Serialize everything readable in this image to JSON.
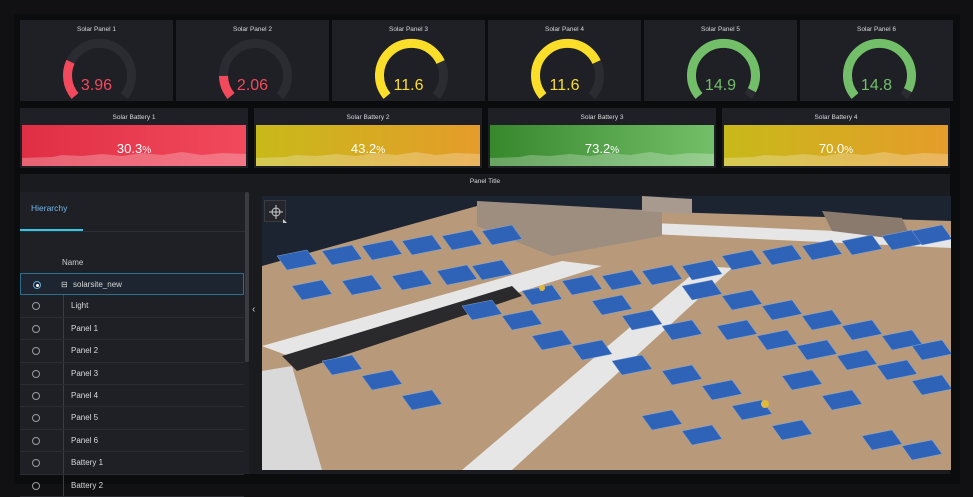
{
  "gauges": [
    {
      "title": "Solar Panel 1",
      "value": "3.96",
      "color": "#f2495c"
    },
    {
      "title": "Solar Panel 2",
      "value": "2.06",
      "color": "#f2495c"
    },
    {
      "title": "Solar Panel 3",
      "value": "11.6",
      "color": "#fade2a"
    },
    {
      "title": "Solar Panel 4",
      "value": "11.6",
      "color": "#fade2a"
    },
    {
      "title": "Solar Panel 5",
      "value": "14.9",
      "color": "#73bf69"
    },
    {
      "title": "Solar Panel 6",
      "value": "14.8",
      "color": "#73bf69"
    }
  ],
  "batteries": [
    {
      "title": "Solar Battery 1",
      "value": "30.3",
      "unit": "%",
      "color_a": "#e02f44",
      "color_b": "#f2495c"
    },
    {
      "title": "Solar Battery 2",
      "value": "43.2",
      "unit": "%",
      "color_a": "#c8b91a",
      "color_b": "#e59c2a"
    },
    {
      "title": "Solar Battery 3",
      "value": "73.2",
      "unit": "%",
      "color_a": "#37872d",
      "color_b": "#73bf69"
    },
    {
      "title": "Solar Battery 4",
      "value": "70.0",
      "unit": "%",
      "color_a": "#c8b91a",
      "color_b": "#e59c2a"
    }
  ],
  "main": {
    "title": "Panel Title",
    "tab": "Hierarchy",
    "column": "Name",
    "rows": [
      {
        "label": "solarsite_new",
        "selected": true,
        "root": true
      },
      {
        "label": "Light"
      },
      {
        "label": "Panel 1"
      },
      {
        "label": "Panel 2"
      },
      {
        "label": "Panel 3"
      },
      {
        "label": "Panel 4"
      },
      {
        "label": "Panel 5"
      },
      {
        "label": "Panel 6"
      },
      {
        "label": "Battery 1"
      },
      {
        "label": "Battery 2"
      }
    ]
  },
  "icons": {
    "collapse": "‹",
    "expand": "⊟"
  }
}
